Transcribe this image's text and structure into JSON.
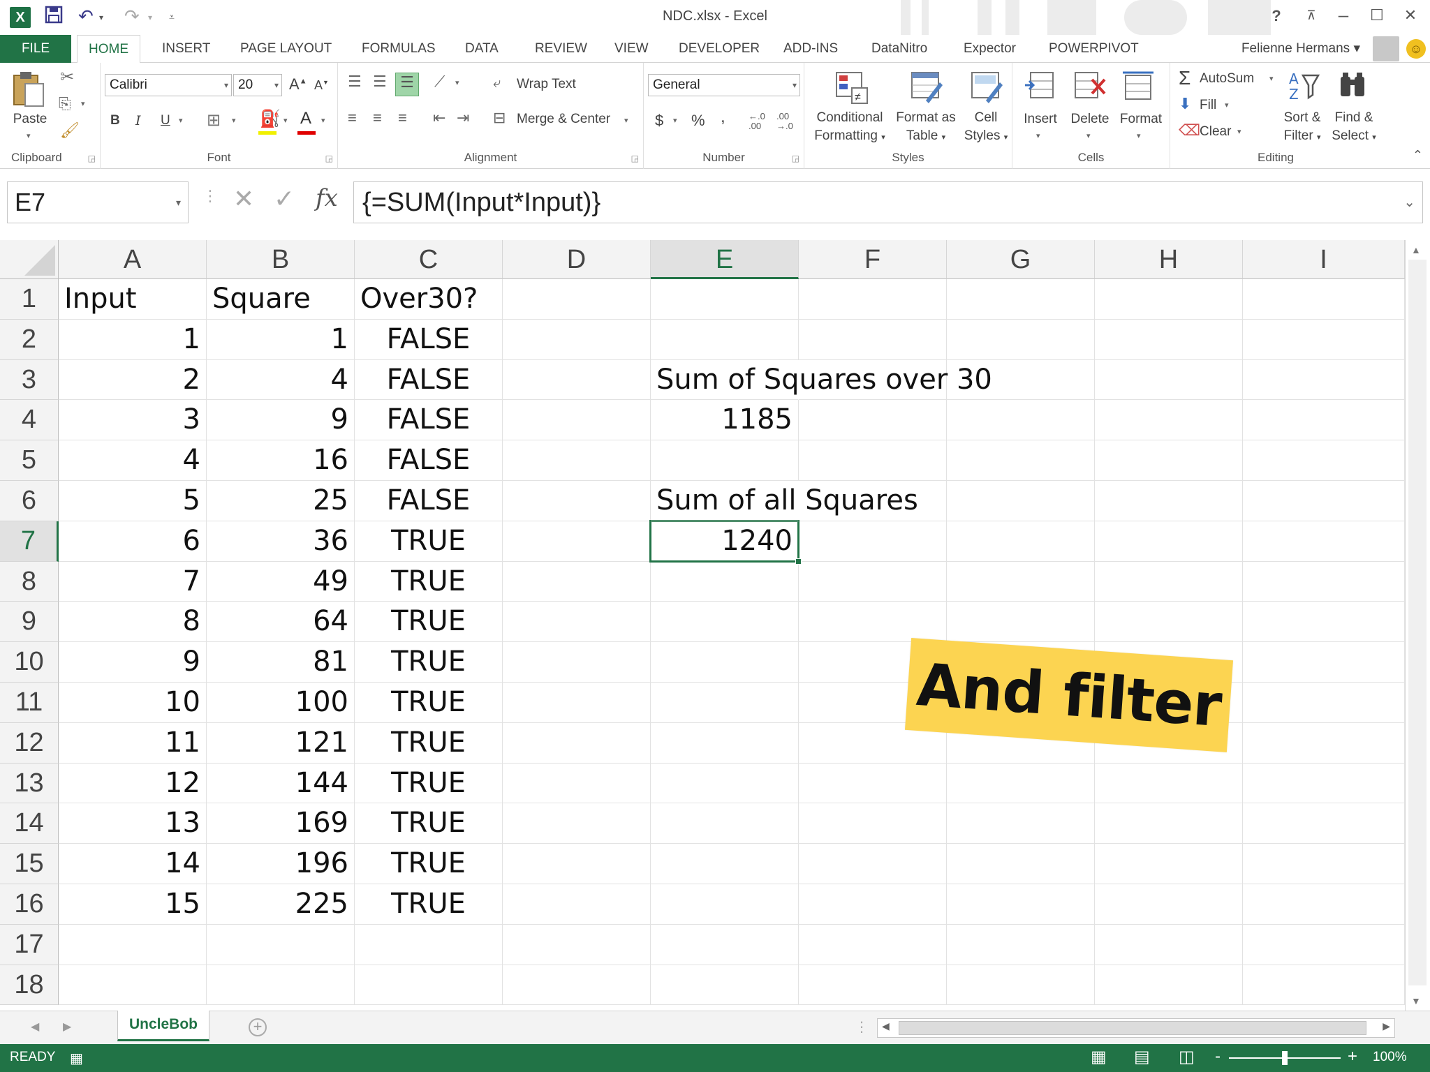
{
  "titlebar": {
    "logo": "X",
    "title": "NDC.xlsx - Excel",
    "help": "?",
    "restore_ribbon": "⊼",
    "minimize": "–",
    "maximize": "☐",
    "close": "✕"
  },
  "tabs": {
    "file": "FILE",
    "items": [
      "HOME",
      "INSERT",
      "PAGE LAYOUT",
      "FORMULAS",
      "DATA",
      "REVIEW",
      "VIEW",
      "DEVELOPER",
      "ADD-INS",
      "DataNitro",
      "Expector",
      "POWERPIVOT"
    ],
    "active": "HOME",
    "user": "Felienne Hermans ▾"
  },
  "ribbon": {
    "clipboard": {
      "label": "Clipboard",
      "paste": "Paste"
    },
    "font": {
      "label": "Font",
      "name": "Calibri",
      "size": "20",
      "bold": "B",
      "italic": "I",
      "underline": "U"
    },
    "alignment": {
      "label": "Alignment",
      "wrap": "Wrap Text",
      "merge": "Merge & Center"
    },
    "number": {
      "label": "Number",
      "format": "General",
      "currency": "$",
      "percent": "%",
      "comma": ","
    },
    "styles": {
      "label": "Styles",
      "conditional": "Conditional",
      "conditional2": "Formatting",
      "format_table": "Format as",
      "format_table2": "Table",
      "cell_styles": "Cell",
      "cell_styles2": "Styles"
    },
    "cells": {
      "label": "Cells",
      "insert": "Insert",
      "delete": "Delete",
      "format": "Format"
    },
    "editing": {
      "label": "Editing",
      "autosum": "AutoSum",
      "fill": "Fill",
      "clear": "Clear",
      "sort": "Sort &",
      "sort2": "Filter",
      "find": "Find &",
      "find2": "Select"
    }
  },
  "formula_bar": {
    "name_box": "E7",
    "formula": "{=SUM(Input*Input)}",
    "fx": "fx"
  },
  "grid": {
    "columns": [
      "A",
      "B",
      "C",
      "D",
      "E",
      "F",
      "G",
      "H",
      "I"
    ],
    "selected_column": "E",
    "selected_row": 7,
    "rows": [
      1,
      2,
      3,
      4,
      5,
      6,
      7,
      8,
      9,
      10,
      11,
      12,
      13,
      14,
      15,
      16,
      17,
      18
    ],
    "headers": {
      "A1": "Input",
      "B1": "Square",
      "C1": "Over30?"
    },
    "data": [
      {
        "input": "1",
        "square": "1",
        "over30": "FALSE"
      },
      {
        "input": "2",
        "square": "4",
        "over30": "FALSE"
      },
      {
        "input": "3",
        "square": "9",
        "over30": "FALSE"
      },
      {
        "input": "4",
        "square": "16",
        "over30": "FALSE"
      },
      {
        "input": "5",
        "square": "25",
        "over30": "FALSE"
      },
      {
        "input": "6",
        "square": "36",
        "over30": "TRUE"
      },
      {
        "input": "7",
        "square": "49",
        "over30": "TRUE"
      },
      {
        "input": "8",
        "square": "64",
        "over30": "TRUE"
      },
      {
        "input": "9",
        "square": "81",
        "over30": "TRUE"
      },
      {
        "input": "10",
        "square": "100",
        "over30": "TRUE"
      },
      {
        "input": "11",
        "square": "121",
        "over30": "TRUE"
      },
      {
        "input": "12",
        "square": "144",
        "over30": "TRUE"
      },
      {
        "input": "13",
        "square": "169",
        "over30": "TRUE"
      },
      {
        "input": "14",
        "square": "196",
        "over30": "TRUE"
      },
      {
        "input": "15",
        "square": "225",
        "over30": "TRUE"
      }
    ],
    "E3": "Sum of Squares over 30",
    "E4": "1185",
    "E6": "Sum of all Squares",
    "E7": "1240"
  },
  "sheets": {
    "active": "UncleBob",
    "add": "+"
  },
  "status": {
    "ready": "READY",
    "zoom": "100%",
    "minus": "-",
    "plus": "+"
  },
  "overlay": {
    "text": "And filter"
  },
  "colors": {
    "excel_green": "#217346",
    "sticker_yellow": "#fcd451"
  }
}
